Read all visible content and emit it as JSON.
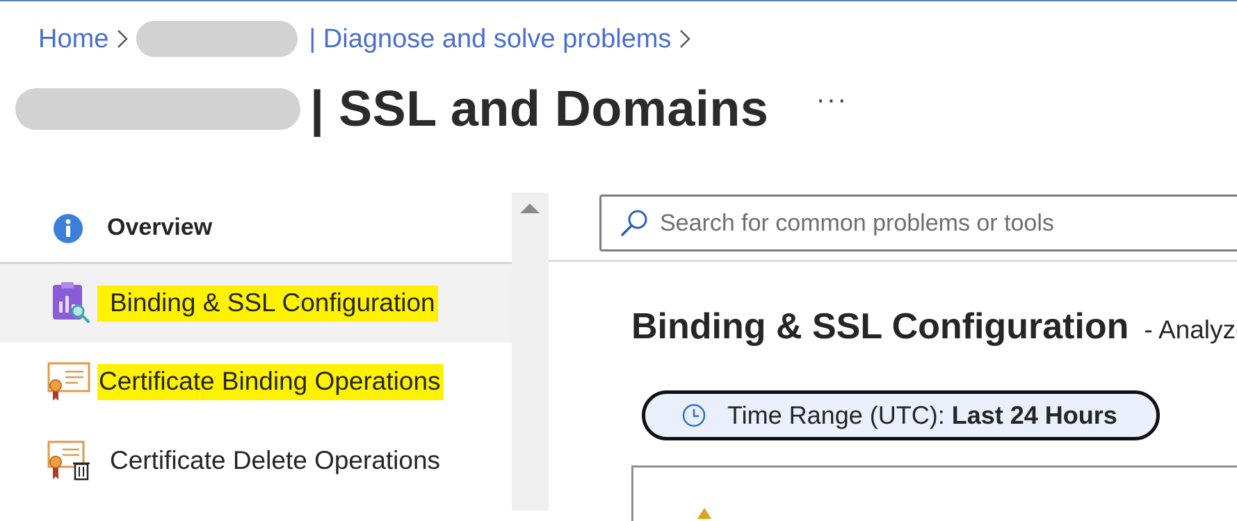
{
  "breadcrumb": {
    "home": "Home",
    "current": "| Diagnose and solve problems"
  },
  "page": {
    "title": "| SSL and Domains",
    "more": "···"
  },
  "nav": {
    "items": [
      {
        "label": "Overview",
        "icon": "info-icon"
      },
      {
        "label": "Binding & SSL Configuration",
        "icon": "clipboard-chart-icon"
      },
      {
        "label": "Certificate Binding Operations",
        "icon": "certificate-icon"
      },
      {
        "label": "Certificate Delete Operations",
        "icon": "certificate-delete-icon"
      }
    ]
  },
  "search": {
    "placeholder": "Search for common problems or tools"
  },
  "section": {
    "title": "Binding & SSL Configuration",
    "subtitle": "-  Analyze"
  },
  "time_range": {
    "label": "Time Range (UTC): ",
    "value": "Last 24 Hours"
  },
  "colors": {
    "link": "#4a6fce",
    "highlight": "#fff200",
    "selected_bg": "#f2f2f2",
    "pill_bg": "#eaf0fb"
  }
}
